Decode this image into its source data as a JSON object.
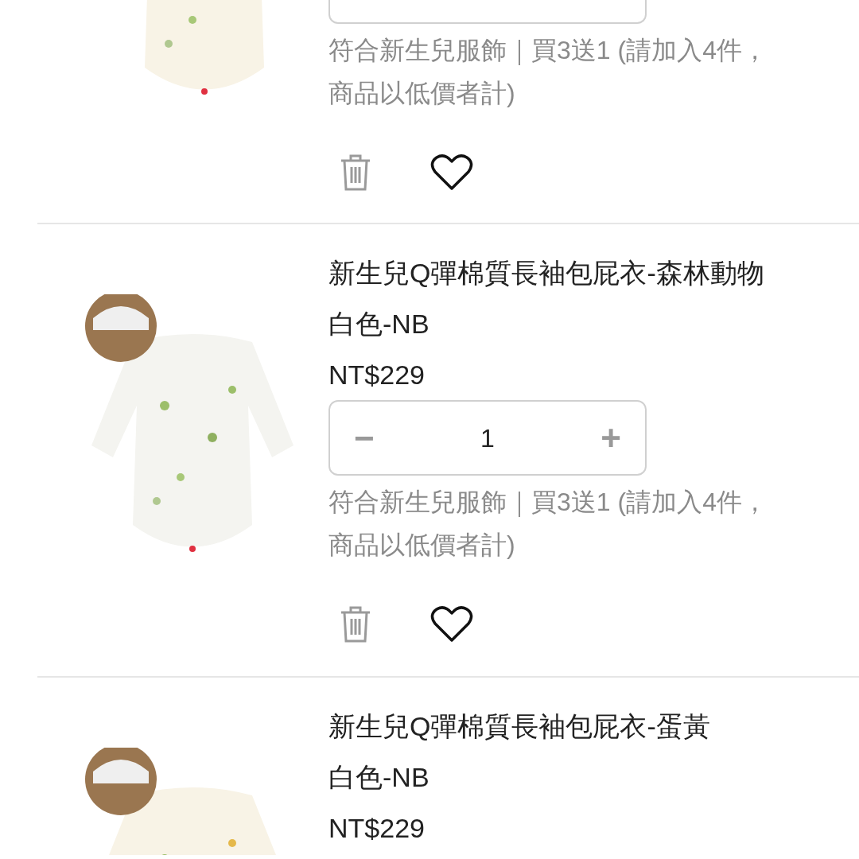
{
  "cart_items": [
    {
      "image": {
        "kind": "picture"
      },
      "quantity_partial": true,
      "promo_lines": [
        "符合新生兒服飾｜買3送1 (請加入4件，",
        "商品以低價者計)"
      ],
      "favorited": false
    },
    {
      "image": {
        "kind": "picture"
      },
      "title": "新生兒Q彈棉質長袖包屁衣-森林動物",
      "variant": "白色-NB",
      "price": "NT$229",
      "quantity": {
        "minus": "−",
        "value": "1",
        "plus": "+"
      },
      "promo_lines": [
        "符合新生兒服飾｜買3送1 (請加入4件，",
        "商品以低價者計)"
      ],
      "favorited": false
    },
    {
      "image": {
        "kind": "picture"
      },
      "title": "新生兒Q彈棉質長袖包屁衣-蛋黃",
      "variant": "白色-NB",
      "price": "NT$229"
    }
  ]
}
